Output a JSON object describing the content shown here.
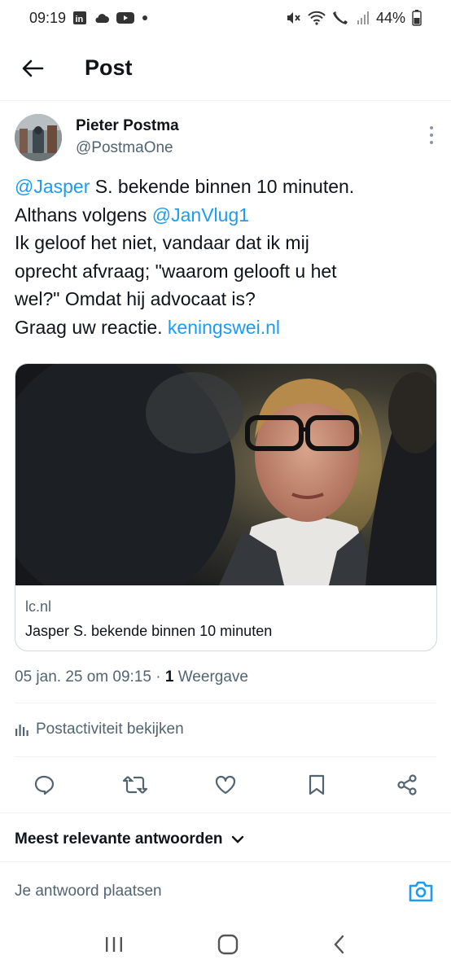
{
  "status": {
    "time": "09:19",
    "battery": "44%",
    "left_icons": [
      "linkedin-icon",
      "cloud-icon",
      "youtube-icon",
      "dot-icon"
    ],
    "right_icons": [
      "mute-icon",
      "wifi-icon",
      "call-icon",
      "signal-icon",
      "battery-icon"
    ]
  },
  "header": {
    "title": "Post"
  },
  "post": {
    "author_name": "Pieter Postma",
    "author_handle": "@PostmaOne",
    "text": {
      "mention1": "@Jasper",
      "line1_rest": " S. bekende binnen 10 minuten.",
      "line2_prefix": "Althans volgens ",
      "mention2": "@JanVlug1",
      "line3": "Ik geloof het niet, vandaar dat ik mij",
      "line4": "oprecht afvraag; \"waarom gelooft u het",
      "line5": "wel?\" Omdat hij advocaat is?",
      "line6_prefix": "Graag uw reactie. ",
      "link": "keningswei.nl"
    },
    "card": {
      "domain": "lc.nl",
      "title": "Jasper S. bekende binnen 10 minuten"
    },
    "date": "05 jan. 25 om 09:15",
    "separator": " · ",
    "views_count": "1",
    "views_label": " Weergave",
    "activity": "Postactiviteit bekijken"
  },
  "actions": [
    "reply-icon",
    "repost-icon",
    "like-icon",
    "bookmark-icon",
    "share-icon"
  ],
  "replies": {
    "sort_label": "Meest relevante antwoorden",
    "placeholder": "Je antwoord plaatsen"
  },
  "colors": {
    "link": "#1d9bf0",
    "text": "#0f1419",
    "secondary": "#536471",
    "divider": "#eff3f4"
  }
}
